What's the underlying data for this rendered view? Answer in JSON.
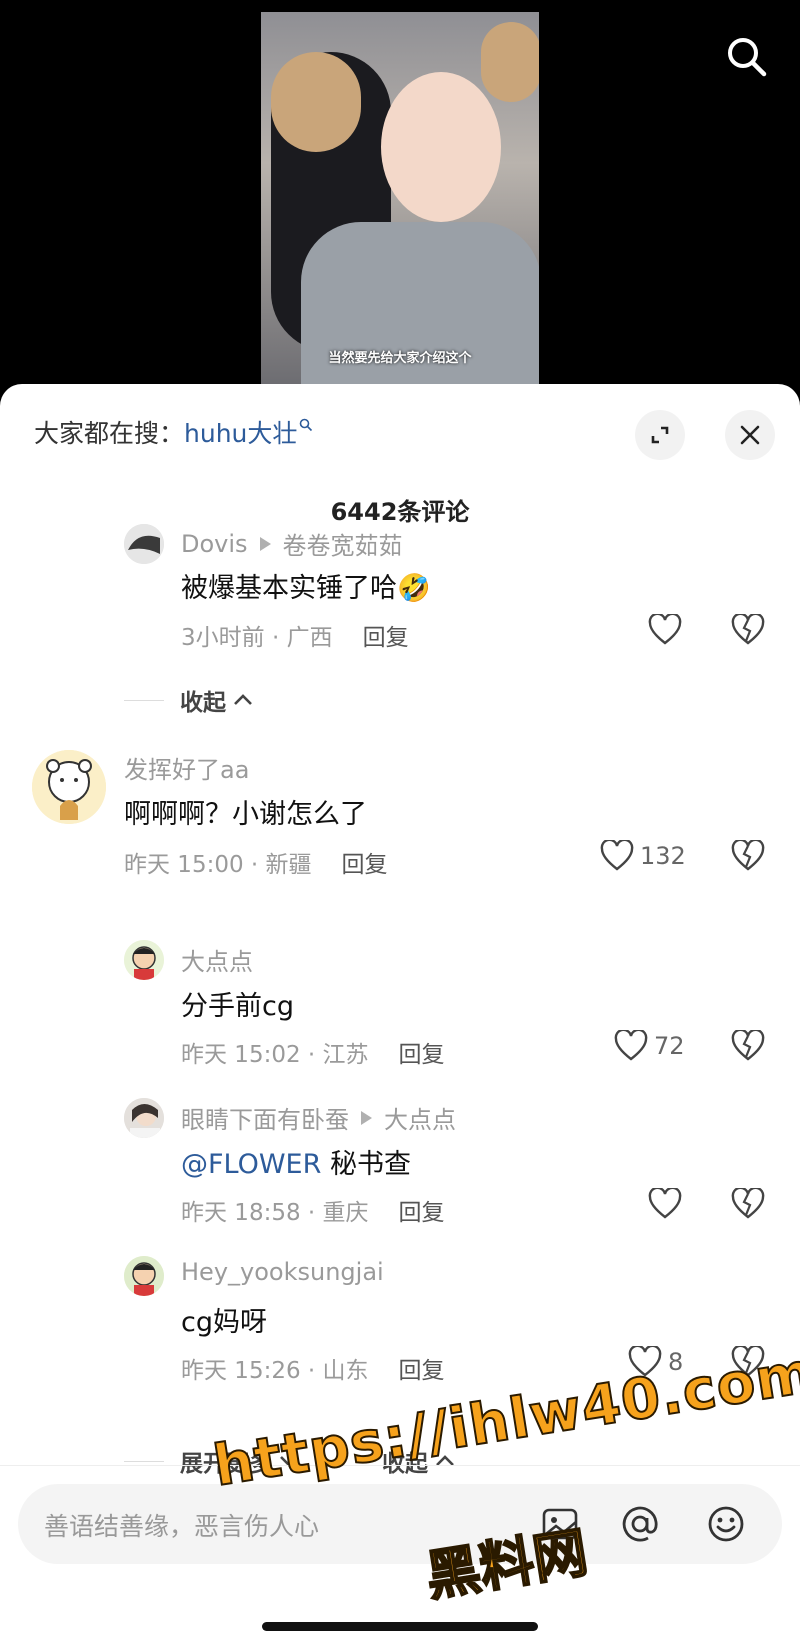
{
  "video": {
    "subtitle": "当然要先给大家介绍这个"
  },
  "sheet": {
    "hot_search_prefix": "大家都在搜：",
    "hot_search_keyword": "huhu大壮",
    "comment_count_title": "6442条评论"
  },
  "comments": [
    {
      "user": "Dovis",
      "reply_to": "卷卷宽茹茹",
      "text": "被爆基本实锤了哈🤣",
      "time_location": "3小时前 · 广西",
      "reply_label": "回复",
      "likes": ""
    },
    {
      "user": "发挥好了aa",
      "reply_to": "",
      "text": "啊啊啊？小谢怎么了",
      "time_location": "昨天 15:00 · 新疆",
      "reply_label": "回复",
      "likes": "132"
    },
    {
      "user": "大点点",
      "reply_to": "",
      "text": "分手前cg",
      "time_location": "昨天 15:02 · 江苏",
      "reply_label": "回复",
      "likes": "72"
    },
    {
      "user": "眼睛下面有卧蚕",
      "reply_to": "大点点",
      "mention": "@FLOWER",
      "text": " 秘书查",
      "time_location": "昨天 18:58 · 重庆",
      "reply_label": "回复",
      "likes": ""
    },
    {
      "user": "Hey_yooksungjai",
      "reply_to": "",
      "text": "cg妈呀",
      "time_location": "昨天 15:26 · 山东",
      "reply_label": "回复",
      "likes": "8"
    }
  ],
  "folds": {
    "collapse": "收起",
    "expand_more": "展开更多",
    "collapse_2": "收起"
  },
  "input": {
    "placeholder": "善语结善缘，恶言伤人心"
  },
  "watermark": {
    "url": "https://ihlw40.com",
    "name": "黑料网"
  },
  "colors": {
    "link_blue": "#2d5b9a",
    "muted_gray": "#9a9a9a",
    "watermark_orange": "#f6a21c"
  }
}
